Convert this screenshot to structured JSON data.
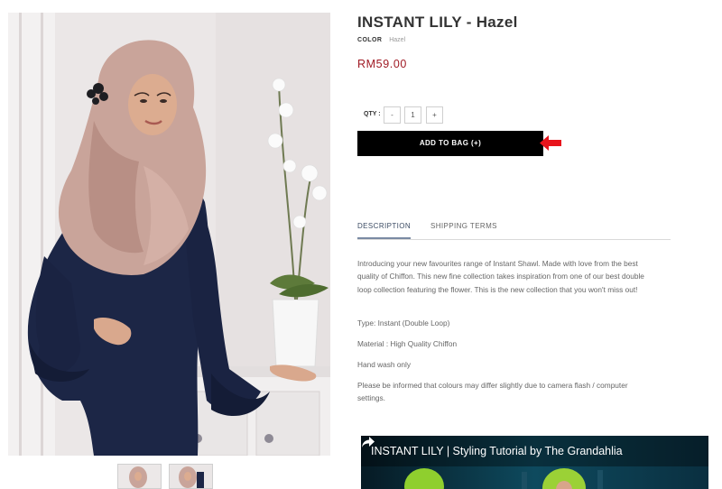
{
  "product": {
    "title": "INSTANT LILY - Hazel",
    "color_label": "COLOR",
    "color_value": "Hazel",
    "price": "RM59.00"
  },
  "quantity": {
    "label": "QTY :",
    "minus": "-",
    "value": "1",
    "plus": "+"
  },
  "add_to_bag": {
    "label": "ADD TO BAG (+)"
  },
  "annotation": {
    "arrow_color": "#e8141c"
  },
  "tabs": [
    {
      "label": "DESCRIPTION",
      "active": true
    },
    {
      "label": "SHIPPING TERMS",
      "active": false
    }
  ],
  "description": {
    "intro": "Introducing your new favourites range of Instant Shawl. Made with love from the best quality of Chiffon. This new fine collection takes inspiration from one of our best double loop collection featuring the flower. This is the new collection that you won't miss out!",
    "type": "Type: Instant (Double Loop)",
    "material": "Material : High Quality Chiffon",
    "care": "Hand wash only",
    "note": "Please be informed that colours may differ slightly due to camera flash / computer settings."
  },
  "video": {
    "title": "INSTANT LILY | Styling Tutorial by The Grandahlia",
    "share_icon": "share-arrow-icon"
  },
  "colors": {
    "price": "#a01a24",
    "button_bg": "#000000",
    "tab_active": "#3b4b63",
    "shawl": "#c9a49a",
    "dress": "#1c2646"
  }
}
